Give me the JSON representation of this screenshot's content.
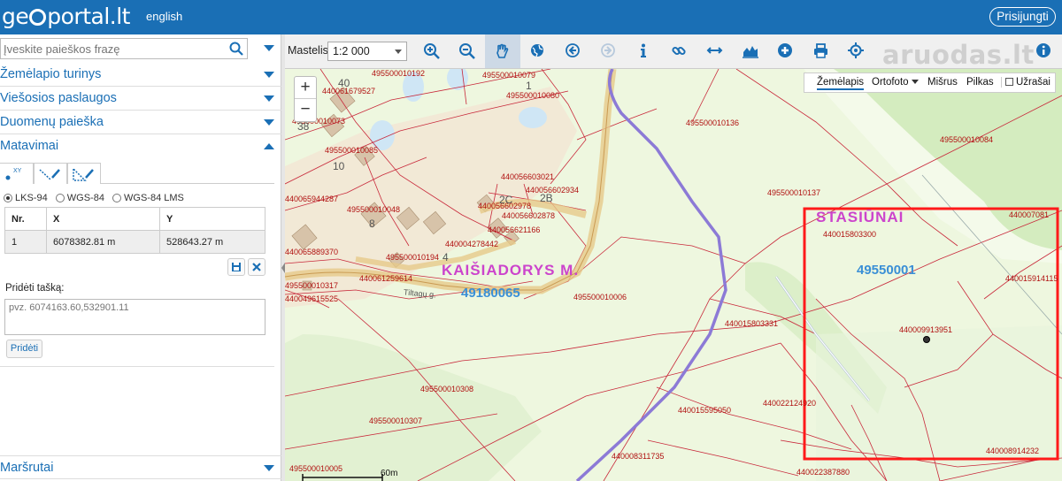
{
  "header": {
    "logo_part1": "ge",
    "logo_part2": "portal.lt",
    "language": "english",
    "login": "Prisijungti"
  },
  "search": {
    "placeholder": "Įveskite paieškos frazę"
  },
  "sidebar": {
    "sections": [
      {
        "label": "Žemėlapio turinys"
      },
      {
        "label": "Viešosios paslaugos"
      },
      {
        "label": "Duomenų paieška"
      },
      {
        "label": "Matavimai"
      }
    ],
    "bottom_section": "Maršrutai",
    "measure": {
      "point_tab_sup": "XY",
      "coord_systems": [
        "LKS-94",
        "WGS-84",
        "WGS-84 LMS"
      ],
      "selected_system": "LKS-94",
      "table_headers": [
        "Nr.",
        "X",
        "Y"
      ],
      "rows": [
        {
          "nr": "1",
          "x": "6078382.81 m",
          "y": "528643.27 m"
        }
      ],
      "add_point_label": "Pridėti tašką:",
      "add_point_placeholder": "pvz. 6074163.60,532901.11",
      "add_button": "Pridėti"
    }
  },
  "toolbar": {
    "scale_label": "Mastelis:",
    "scale_value": "1:2 000",
    "tools": [
      "zoom-in-icon",
      "zoom-out-icon",
      "pan-icon",
      "globe-icon",
      "back-icon",
      "forward-icon",
      "info-icon",
      "link-icon",
      "measure-distance-icon",
      "profile-icon",
      "add-icon",
      "print-icon",
      "locate-icon"
    ],
    "watermark": "aruodas.lt"
  },
  "map": {
    "layers": {
      "map": "Žemėlapis",
      "ortho": "Ortofoto",
      "mixed": "Mišrus",
      "gray": "Pilkas",
      "labels": "Užrašai"
    },
    "place_labels": {
      "kaisiadorys": "KAIŠIADORYS M.",
      "kaisiadorys_code": "49180065",
      "stasiunai": "STASIŪNAI",
      "stasiunai_code": "49550001",
      "street": "Tiltagų g."
    },
    "parcels": [
      "495500010192",
      "495500010079",
      "440061679527",
      "495500010080",
      "495500010136",
      "495500010084",
      "495500010073",
      "440056603021",
      "440056602934",
      "440056602978",
      "440056602878",
      "440056621166",
      "495500010048",
      "440065944287",
      "495500010085",
      "440004278442",
      "495500010194",
      "440065889370",
      "440061259614",
      "495500010317",
      "440049615525",
      "495500010006",
      "495500010137",
      "440015803300",
      "440007081",
      "440015914115",
      "440015803331",
      "440009913951",
      "495500010308",
      "440022124920",
      "440015595050",
      "495500010307",
      "440008311735",
      "440008914232",
      "495500010005",
      "440022387880"
    ],
    "house_numbers": [
      "40",
      "1",
      "38",
      "10",
      "8",
      "2C",
      "2B",
      "4"
    ],
    "scale_bar": "60m"
  },
  "colors": {
    "header": "#1a6fb5",
    "map_background": "#eef7df",
    "parcel_lines": "#c8283a",
    "boundary": "#8c7ad6",
    "highlight": "#ff1a1a",
    "place_label_pink": "#cc44cc",
    "place_code_blue": "#3a8fd6"
  }
}
